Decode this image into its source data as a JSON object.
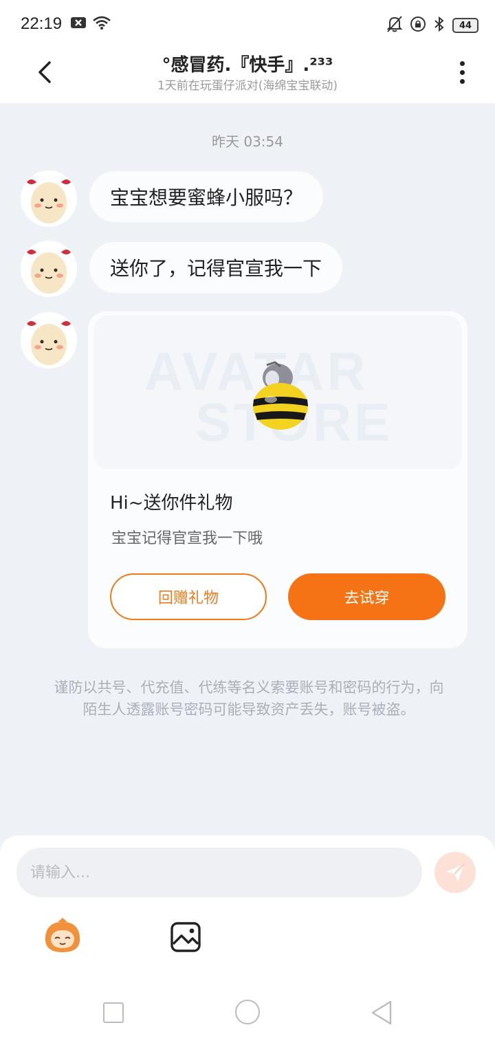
{
  "status_bar": {
    "time": "22:19",
    "battery": "44"
  },
  "header": {
    "title": "°感冒药.『快手』.²³³",
    "subtitle": "1天前在玩蛋仔派对(海绵宝宝联动)"
  },
  "chat": {
    "timestamp": "昨天 03:54",
    "messages": [
      {
        "text": "宝宝想要蜜蜂小服吗？"
      },
      {
        "text": "送你了，记得官宣我一下"
      }
    ],
    "gift_card": {
      "watermark_line1": "AVATAR",
      "watermark_line2": "STORE",
      "title": "Hi~送你件礼物",
      "description": "宝宝记得官宣我一下哦",
      "return_gift_label": "回赠礼物",
      "try_on_label": "去试穿"
    },
    "warning": "谨防以共号、代充值、代练等名义索要账号和密码的行为，向陌生人透露账号密码可能导致资产丢失，账号被盗。"
  },
  "composer": {
    "placeholder": "请输入..."
  },
  "colors": {
    "accent": "#f57314",
    "background": "#eef2f6"
  }
}
